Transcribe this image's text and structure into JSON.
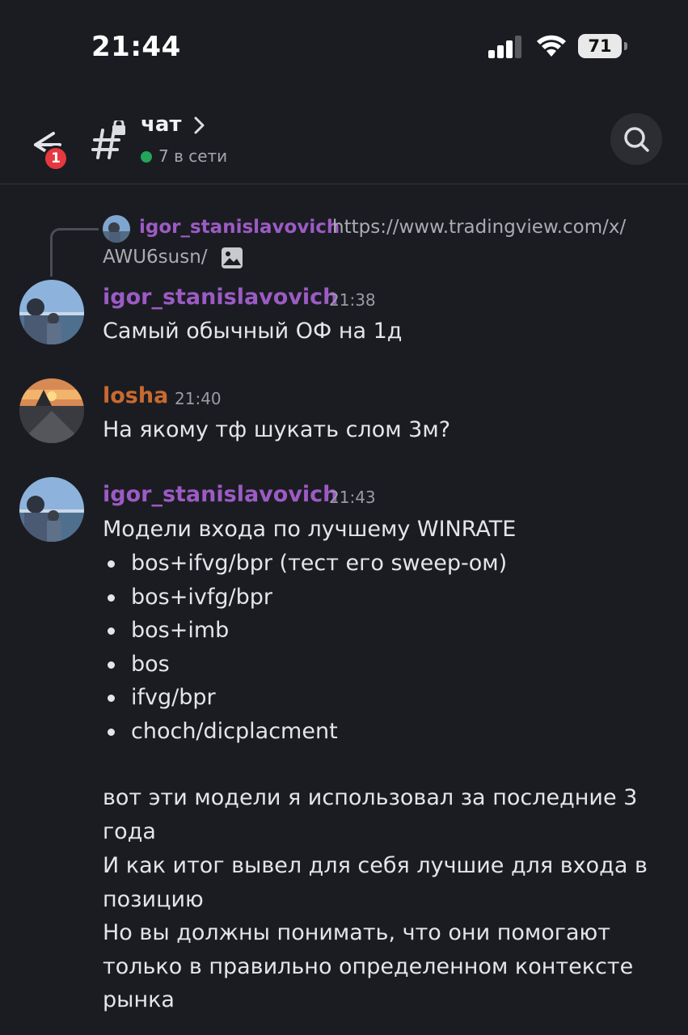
{
  "status_bar": {
    "time": "21:44",
    "battery": "71"
  },
  "header": {
    "back_badge": "1",
    "channel_name": "чат",
    "presence": "7 в сети",
    "icons": [
      "back-arrow-icon",
      "channel-hash-lock-icon",
      "chevron-right-icon",
      "search-icon"
    ]
  },
  "reply_preview": {
    "username": "igor_stanislavovich",
    "text": "https://www.tradingview.com/x/",
    "text_cont": "AWU6susn/",
    "attachment_icon": "image-icon"
  },
  "messages": [
    {
      "username": "igor_stanislavovich",
      "time": "21:38",
      "text": "Самый обычный ОФ на 1д",
      "name_color": "#9c5bc4"
    },
    {
      "username": "losha",
      "time": "21:40",
      "text": "На якому тф шукать слом 3м?",
      "name_color": "#c96a2f"
    },
    {
      "username": "igor_stanislavovich",
      "time": "21:43",
      "intro": "Модели входа по лучшему WINRATE",
      "bullets": [
        "bos+ifvg/bpr (тест его sweep-ом)",
        "bos+ivfg/bpr",
        "bos+imb",
        "bos",
        "ifvg/bpr",
        "choch/dicplacment"
      ],
      "paragraph_1": "вот эти модели я использовал за последние 3 года",
      "paragraph_2": "И как итог вывел для себя лучшие для входа в позицию",
      "paragraph_3": "Но вы должны понимать, что они помогают только в правильно определенном контексте рынка",
      "name_color": "#9c5bc4"
    }
  ],
  "colors": {
    "background": "#1b1c22",
    "online": "#23a55a",
    "badge": "#e5383f"
  }
}
